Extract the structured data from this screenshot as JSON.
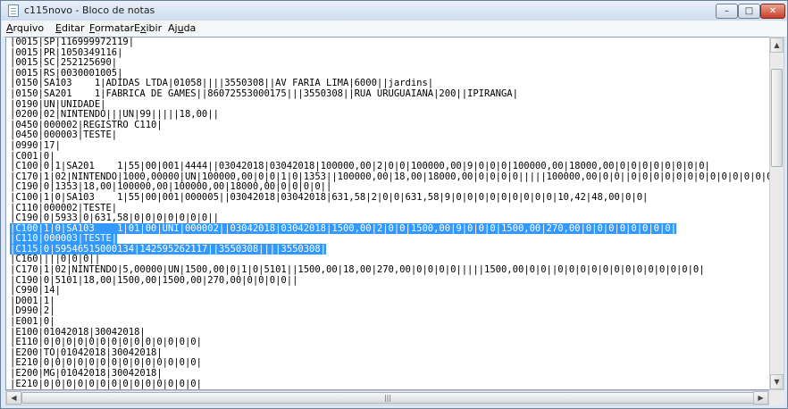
{
  "window": {
    "title": "c115novo - Bloco de notas",
    "minimize": "–",
    "maximize": "□",
    "close": "✕"
  },
  "menu": {
    "arquivo": {
      "key": "A",
      "rest": "rquivo"
    },
    "editar": {
      "key": "E",
      "rest": "ditar"
    },
    "formatar": {
      "key": "F",
      "rest": "ormatar"
    },
    "exibir": {
      "pre": "E",
      "key": "x",
      "rest": "ibir"
    },
    "ajuda": {
      "pre": "Aj",
      "key": "u",
      "rest": "da"
    }
  },
  "editor": {
    "lines": [
      {
        "text": "|0015|SP|116999972119|",
        "selected": false
      },
      {
        "text": "|0015|PR|1050349116|",
        "selected": false
      },
      {
        "text": "|0015|SC|252125690|",
        "selected": false
      },
      {
        "text": "|0015|RS|0030001005|",
        "selected": false
      },
      {
        "text": "|0150|SA103    1|ADIDAS LTDA|01058||||3550308||AV FARIA LIMA|6000||jardins|",
        "selected": false
      },
      {
        "text": "|0150|SA201    1|FABRICA DE GAMES||86072553000175|||3550308||RUA URUGUAIANA|200||IPIRANGA|",
        "selected": false
      },
      {
        "text": "|0190|UN|UNIDADE|",
        "selected": false
      },
      {
        "text": "|0200|02|NINTENDO|||UN|99|||||18,00||",
        "selected": false
      },
      {
        "text": "|0450|000002|REGISTRO C110|",
        "selected": false
      },
      {
        "text": "|0450|000003|TESTE|",
        "selected": false
      },
      {
        "text": "|0990|17|",
        "selected": false
      },
      {
        "text": "|C001|0|",
        "selected": false
      },
      {
        "text": "|C100|0|1|SA201    1|55|00|001|4444||03042018|03042018|100000,00|2|0|0|100000,00|9|0|0|0|100000,00|18000,00|0|0|0|0|0|0|0|0|",
        "selected": false
      },
      {
        "text": "|C170|1|02|NINTENDO|1000,00000|UN|100000,00|0|0|1|0|1353||100000,00|18,00|18000,00|0|0|0|0|||||100000,00|0|0||0|0|0|0|0|0|0|0|0|0|0|0|0|",
        "selected": false
      },
      {
        "text": "|C190|0|1353|18,00|100000,00|100000,00|18000,00|0|0|0|0||",
        "selected": false
      },
      {
        "text": "|C100|1|0|SA103    1|55|00|001|000005||03042018|03042018|631,58|2|0|0|631,58|9|0|0|0|0|0|0|0|0|0|10,42|48,00|0|0|",
        "selected": false
      },
      {
        "text": "|C110|000002|TESTE|",
        "selected": false
      },
      {
        "text": "|C190|0|5933|0|631,58|0|0|0|0|0|0|0||",
        "selected": false
      },
      {
        "text": "|C100|1|0|SA103    1|01|00|UNI|000002||03042018|03042018|1500,00|2|0|0|1500,00|9|0|0|0|1500,00|270,00|0|0|0|0|0|0|0|0|",
        "selected": true
      },
      {
        "text": "|C110|000003|TESTE|",
        "selected": true
      },
      {
        "text": "|C115|0|59546515000134|142595262117||3550308||||3550308|",
        "selected": true
      },
      {
        "text": "|C160||||0|0|0||",
        "selected": false
      },
      {
        "text": "|C170|1|02|NINTENDO|5,00000|UN|1500,00|0|1|0|5101||1500,00|18,00|270,00|0|0|0|0|||||1500,00|0|0||0|0|0|0|0|0|0|0|0|0|0|0|0|",
        "selected": false
      },
      {
        "text": "|C190|0|5101|18,00|1500,00|1500,00|270,00|0|0|0|0||",
        "selected": false
      },
      {
        "text": "|C990|14|",
        "selected": false
      },
      {
        "text": "|D001|1|",
        "selected": false
      },
      {
        "text": "|D990|2|",
        "selected": false
      },
      {
        "text": "|E001|0|",
        "selected": false
      },
      {
        "text": "|E100|01042018|30042018|",
        "selected": false
      },
      {
        "text": "|E110|0|0|0|0|0|0|0|0|0|0|0|0|0|0|",
        "selected": false
      },
      {
        "text": "|E200|TO|01042018|30042018|",
        "selected": false
      },
      {
        "text": "|E210|0|0|0|0|0|0|0|0|0|0|0|0|0|0|",
        "selected": false
      },
      {
        "text": "|E200|MG|01042018|30042018|",
        "selected": false
      },
      {
        "text": "|E210|0|0|0|0|0|0|0|0|0|0|0|0|0|0|",
        "selected": false
      },
      {
        "text": "|E200|RJ|01042018|30042018|",
        "selected": false
      }
    ]
  },
  "scrollbars": {
    "up": "▲",
    "down": "▼",
    "left": "◀",
    "right": "▶",
    "grip": "|||"
  }
}
